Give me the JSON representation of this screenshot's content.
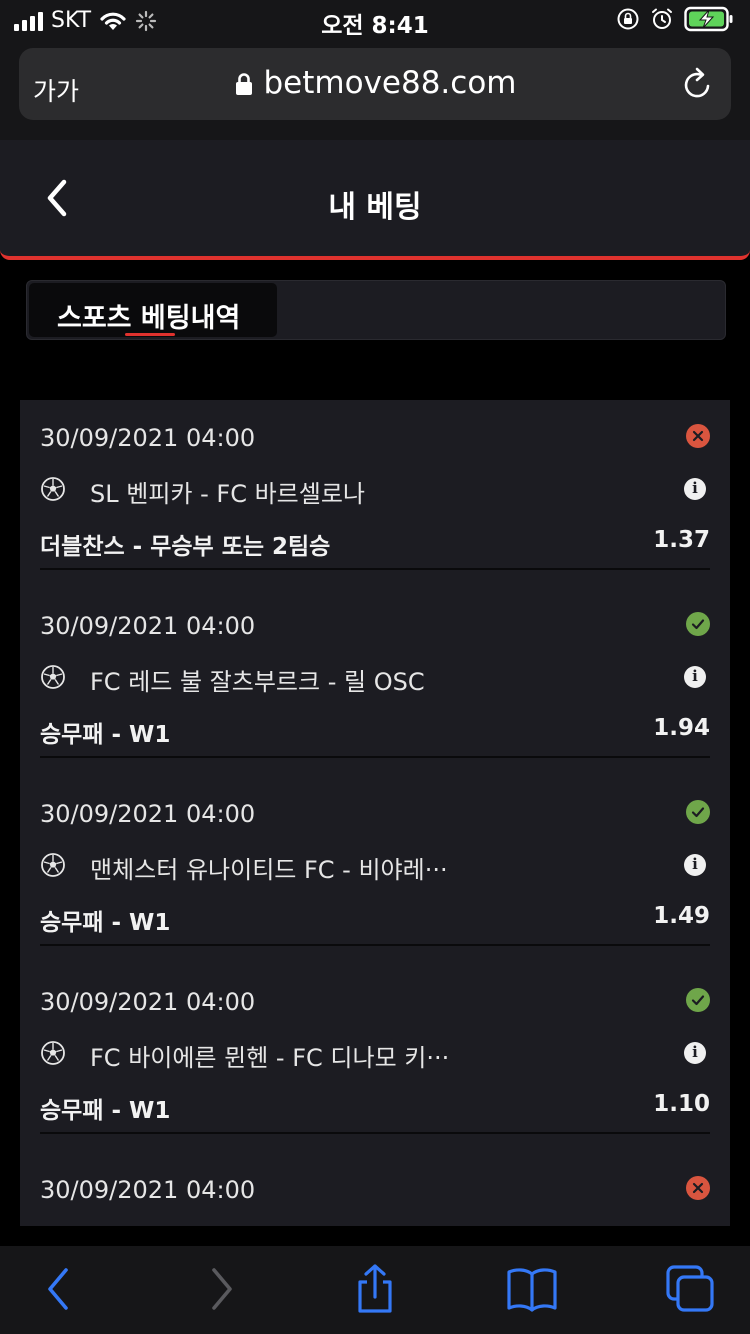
{
  "status_bar": {
    "carrier": "SKT",
    "time": "오전 8:41"
  },
  "browser": {
    "text_size_label": "가가",
    "url": "betmove88.com"
  },
  "header": {
    "title": "내 베팅"
  },
  "tabs": [
    {
      "label": "스포츠 베팅내역",
      "active": true
    }
  ],
  "bets": [
    {
      "date": "30/09/2021 04:00",
      "status": "lost",
      "match": "SL 벤피카 - FC 바르셀로나",
      "market": "더블찬스 - 무승부 또는 2팀승",
      "odds": "1.37"
    },
    {
      "date": "30/09/2021 04:00",
      "status": "won",
      "match": "FC 레드 불 잘츠부르크 - 릴 OSC",
      "market": "승무패 - W1",
      "odds": "1.94"
    },
    {
      "date": "30/09/2021 04:00",
      "status": "won",
      "match": "맨체스터 유나이티드 FC - 비야레···",
      "market": "승무패 - W1",
      "odds": "1.49"
    },
    {
      "date": "30/09/2021 04:00",
      "status": "won",
      "match": "FC 바이에른 뮌헨 - FC 디나모 키···",
      "market": "승무패 - W1",
      "odds": "1.10"
    },
    {
      "date": "30/09/2021 04:00",
      "status": "lost",
      "match": "",
      "market": "",
      "odds": ""
    }
  ],
  "colors": {
    "accent": "#e0322e",
    "won": "#6fa64a",
    "lost": "#d9553f",
    "ios_blue": "#3478f6"
  },
  "icons": {
    "lost": "x-circle-icon",
    "won": "check-circle-icon",
    "sport": "soccer-ball-icon",
    "info": "info-icon"
  }
}
